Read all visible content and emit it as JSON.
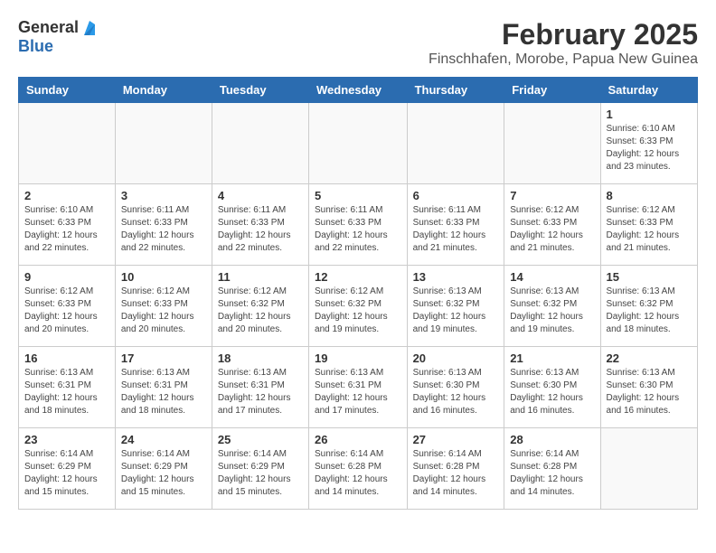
{
  "header": {
    "logo_general": "General",
    "logo_blue": "Blue",
    "month_title": "February 2025",
    "location": "Finschhafen, Morobe, Papua New Guinea"
  },
  "weekdays": [
    "Sunday",
    "Monday",
    "Tuesday",
    "Wednesday",
    "Thursday",
    "Friday",
    "Saturday"
  ],
  "weeks": [
    {
      "days": [
        {
          "number": "",
          "info": ""
        },
        {
          "number": "",
          "info": ""
        },
        {
          "number": "",
          "info": ""
        },
        {
          "number": "",
          "info": ""
        },
        {
          "number": "",
          "info": ""
        },
        {
          "number": "",
          "info": ""
        },
        {
          "number": "1",
          "info": "Sunrise: 6:10 AM\nSunset: 6:33 PM\nDaylight: 12 hours\nand 23 minutes."
        }
      ]
    },
    {
      "days": [
        {
          "number": "2",
          "info": "Sunrise: 6:10 AM\nSunset: 6:33 PM\nDaylight: 12 hours\nand 22 minutes."
        },
        {
          "number": "3",
          "info": "Sunrise: 6:11 AM\nSunset: 6:33 PM\nDaylight: 12 hours\nand 22 minutes."
        },
        {
          "number": "4",
          "info": "Sunrise: 6:11 AM\nSunset: 6:33 PM\nDaylight: 12 hours\nand 22 minutes."
        },
        {
          "number": "5",
          "info": "Sunrise: 6:11 AM\nSunset: 6:33 PM\nDaylight: 12 hours\nand 22 minutes."
        },
        {
          "number": "6",
          "info": "Sunrise: 6:11 AM\nSunset: 6:33 PM\nDaylight: 12 hours\nand 21 minutes."
        },
        {
          "number": "7",
          "info": "Sunrise: 6:12 AM\nSunset: 6:33 PM\nDaylight: 12 hours\nand 21 minutes."
        },
        {
          "number": "8",
          "info": "Sunrise: 6:12 AM\nSunset: 6:33 PM\nDaylight: 12 hours\nand 21 minutes."
        }
      ]
    },
    {
      "days": [
        {
          "number": "9",
          "info": "Sunrise: 6:12 AM\nSunset: 6:33 PM\nDaylight: 12 hours\nand 20 minutes."
        },
        {
          "number": "10",
          "info": "Sunrise: 6:12 AM\nSunset: 6:33 PM\nDaylight: 12 hours\nand 20 minutes."
        },
        {
          "number": "11",
          "info": "Sunrise: 6:12 AM\nSunset: 6:32 PM\nDaylight: 12 hours\nand 20 minutes."
        },
        {
          "number": "12",
          "info": "Sunrise: 6:12 AM\nSunset: 6:32 PM\nDaylight: 12 hours\nand 19 minutes."
        },
        {
          "number": "13",
          "info": "Sunrise: 6:13 AM\nSunset: 6:32 PM\nDaylight: 12 hours\nand 19 minutes."
        },
        {
          "number": "14",
          "info": "Sunrise: 6:13 AM\nSunset: 6:32 PM\nDaylight: 12 hours\nand 19 minutes."
        },
        {
          "number": "15",
          "info": "Sunrise: 6:13 AM\nSunset: 6:32 PM\nDaylight: 12 hours\nand 18 minutes."
        }
      ]
    },
    {
      "days": [
        {
          "number": "16",
          "info": "Sunrise: 6:13 AM\nSunset: 6:31 PM\nDaylight: 12 hours\nand 18 minutes."
        },
        {
          "number": "17",
          "info": "Sunrise: 6:13 AM\nSunset: 6:31 PM\nDaylight: 12 hours\nand 18 minutes."
        },
        {
          "number": "18",
          "info": "Sunrise: 6:13 AM\nSunset: 6:31 PM\nDaylight: 12 hours\nand 17 minutes."
        },
        {
          "number": "19",
          "info": "Sunrise: 6:13 AM\nSunset: 6:31 PM\nDaylight: 12 hours\nand 17 minutes."
        },
        {
          "number": "20",
          "info": "Sunrise: 6:13 AM\nSunset: 6:30 PM\nDaylight: 12 hours\nand 16 minutes."
        },
        {
          "number": "21",
          "info": "Sunrise: 6:13 AM\nSunset: 6:30 PM\nDaylight: 12 hours\nand 16 minutes."
        },
        {
          "number": "22",
          "info": "Sunrise: 6:13 AM\nSunset: 6:30 PM\nDaylight: 12 hours\nand 16 minutes."
        }
      ]
    },
    {
      "days": [
        {
          "number": "23",
          "info": "Sunrise: 6:14 AM\nSunset: 6:29 PM\nDaylight: 12 hours\nand 15 minutes."
        },
        {
          "number": "24",
          "info": "Sunrise: 6:14 AM\nSunset: 6:29 PM\nDaylight: 12 hours\nand 15 minutes."
        },
        {
          "number": "25",
          "info": "Sunrise: 6:14 AM\nSunset: 6:29 PM\nDaylight: 12 hours\nand 15 minutes."
        },
        {
          "number": "26",
          "info": "Sunrise: 6:14 AM\nSunset: 6:28 PM\nDaylight: 12 hours\nand 14 minutes."
        },
        {
          "number": "27",
          "info": "Sunrise: 6:14 AM\nSunset: 6:28 PM\nDaylight: 12 hours\nand 14 minutes."
        },
        {
          "number": "28",
          "info": "Sunrise: 6:14 AM\nSunset: 6:28 PM\nDaylight: 12 hours\nand 14 minutes."
        },
        {
          "number": "",
          "info": ""
        }
      ]
    }
  ]
}
